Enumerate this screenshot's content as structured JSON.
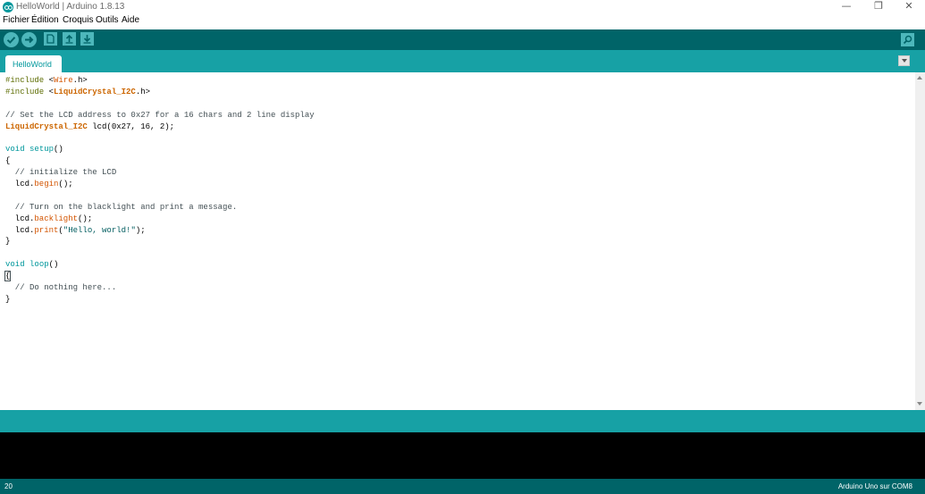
{
  "window": {
    "title": "HelloWorld | Arduino 1.8.13",
    "controls": {
      "minimize": "—",
      "restore": "❐",
      "close": "✕"
    }
  },
  "menu": {
    "items": [
      "Fichier",
      "Édition",
      "Croquis",
      "Outils",
      "Aide"
    ]
  },
  "toolbar": {
    "buttons": [
      "verify-icon",
      "upload-icon",
      "new-icon",
      "open-icon",
      "save-icon",
      "serial-monitor-icon"
    ]
  },
  "tabs": [
    {
      "label": "HelloWorld"
    }
  ],
  "editor": {
    "lines": [
      [
        {
          "t": "#include ",
          "c": "pre"
        },
        {
          "t": "<",
          "c": "plain"
        },
        {
          "t": "Wire",
          "c": "inc"
        },
        {
          "t": ".h>",
          "c": "plain"
        }
      ],
      [
        {
          "t": "#include ",
          "c": "pre"
        },
        {
          "t": "<",
          "c": "plain"
        },
        {
          "t": "LiquidCrystal_I2C",
          "c": "type"
        },
        {
          "t": ".h>",
          "c": "plain"
        }
      ],
      [],
      [
        {
          "t": "// Set the LCD address to 0x27 for a 16 chars and 2 line display",
          "c": "comment"
        }
      ],
      [
        {
          "t": "LiquidCrystal_I2C",
          "c": "type"
        },
        {
          "t": " lcd(0x27, 16, 2);",
          "c": "plain"
        }
      ],
      [],
      [
        {
          "t": "void",
          "c": "kw"
        },
        {
          "t": " ",
          "c": "plain"
        },
        {
          "t": "setup",
          "c": "kw"
        },
        {
          "t": "()",
          "c": "plain"
        }
      ],
      [
        {
          "t": "{",
          "c": "plain"
        }
      ],
      [
        {
          "t": "  // initialize the LCD",
          "c": "comment"
        }
      ],
      [
        {
          "t": "  lcd.",
          "c": "plain"
        },
        {
          "t": "begin",
          "c": "fn"
        },
        {
          "t": "();",
          "c": "plain"
        }
      ],
      [],
      [
        {
          "t": "  // Turn on the blacklight and print a message.",
          "c": "comment"
        }
      ],
      [
        {
          "t": "  lcd.",
          "c": "plain"
        },
        {
          "t": "backlight",
          "c": "fn"
        },
        {
          "t": "();",
          "c": "plain"
        }
      ],
      [
        {
          "t": "  lcd.",
          "c": "plain"
        },
        {
          "t": "print",
          "c": "fn"
        },
        {
          "t": "(",
          "c": "plain"
        },
        {
          "t": "\"Hello, world!\"",
          "c": "str"
        },
        {
          "t": ");",
          "c": "plain"
        }
      ],
      [
        {
          "t": "}",
          "c": "plain"
        }
      ],
      [],
      [
        {
          "t": "void",
          "c": "kw"
        },
        {
          "t": " ",
          "c": "plain"
        },
        {
          "t": "loop",
          "c": "kw"
        },
        {
          "t": "()",
          "c": "plain"
        }
      ],
      [
        {
          "t": "{",
          "c": "plain",
          "cursor": true
        }
      ],
      [
        {
          "t": "  // Do nothing here...",
          "c": "comment"
        }
      ],
      [
        {
          "t": "}",
          "c": "plain"
        }
      ]
    ]
  },
  "status": {
    "line_number": "20",
    "board": "Arduino Uno sur COM8"
  },
  "colors": {
    "toolbar": "#006468",
    "tabstrip": "#17a1a5",
    "button": "#4db7bb",
    "console": "#000000"
  }
}
